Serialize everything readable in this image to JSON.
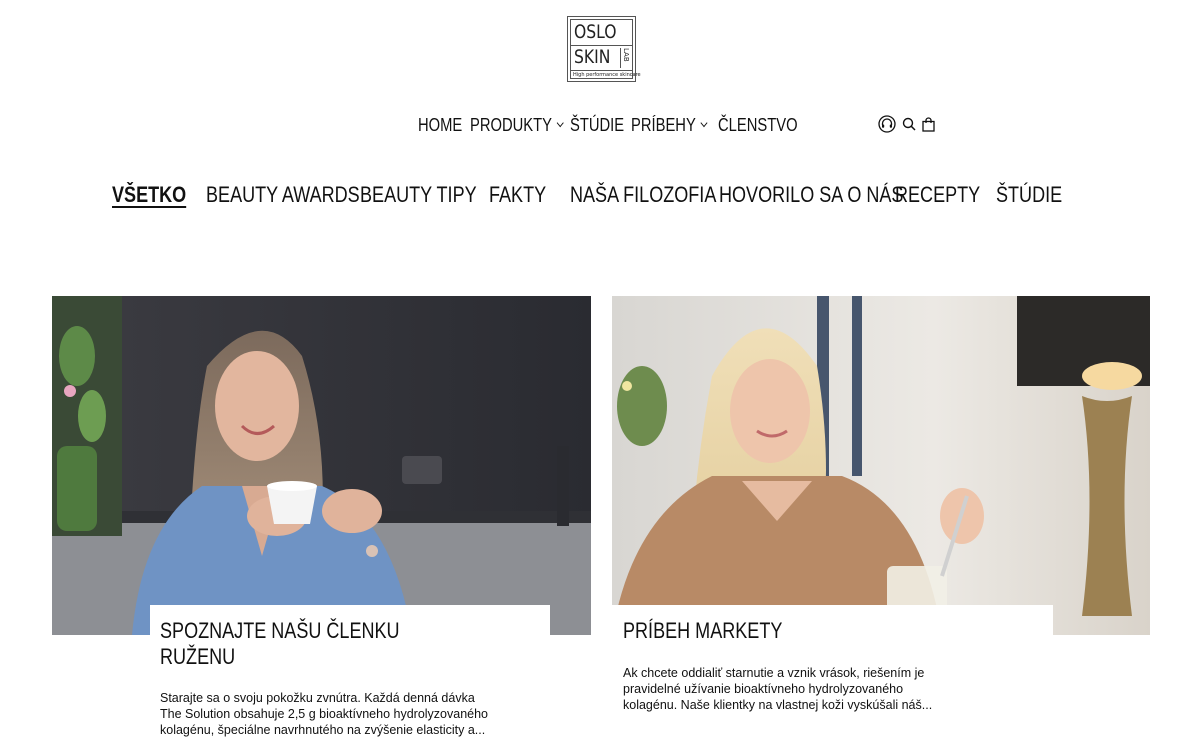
{
  "logo": {
    "line1": "OSLO",
    "line2": "SKIN",
    "lab": "LAB",
    "tagline": "High performance skincare"
  },
  "nav": {
    "items": [
      {
        "label": "HOME",
        "has_dropdown": false
      },
      {
        "label": "PRODUKTY",
        "has_dropdown": true
      },
      {
        "label": "ŠTÚDIE",
        "has_dropdown": false
      },
      {
        "label": "PRÍBEHY",
        "has_dropdown": true
      },
      {
        "label": "ČLENSTVO",
        "has_dropdown": false
      }
    ],
    "icons": [
      "headset-icon",
      "search-icon",
      "cart-icon"
    ]
  },
  "categories": {
    "active": "VŠETKO",
    "items": [
      "VŠETKO",
      "BEAUTY AWARDS",
      "BEAUTY TIPY",
      "FAKTY",
      "NAŠA FILOZOFIA",
      "HOVORILO SA O NÁS",
      "RECEPTY",
      "ŠTÚDIE"
    ]
  },
  "articles": [
    {
      "title_line1": "SPOZNAJTE NAŠU ČLENKU",
      "title_line2": "RUŽENU",
      "excerpt_lines": [
        "Starajte sa o svoju pokožku zvnútra. Každá denná dávka",
        "The Solution obsahuje 2,5 g bioaktívneho hydrolyzovaného",
        "kolagénu, špeciálne navrhnutého na zvýšenie elasticity a..."
      ]
    },
    {
      "title_line1": "PRÍBEH MARKETY",
      "excerpt_lines": [
        "Ak chcete oddialiť starnutie a vznik vrások, riešením je",
        "pravidelné užívanie bioaktívneho hydrolyzovaného",
        "kolagénu. Naše klientky na vlastnej koži vyskúšali náš..."
      ]
    }
  ]
}
